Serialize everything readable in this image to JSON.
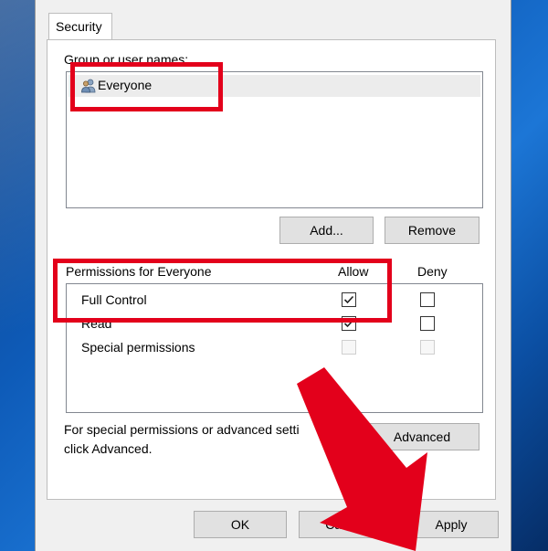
{
  "dialog": {
    "tab_label": "Security",
    "group_label": "Group or user names:",
    "users": [
      {
        "name": "Everyone",
        "icon": "users-group-icon",
        "selected": true
      }
    ],
    "add_button": "Add...",
    "remove_button": "Remove",
    "permissions_label": "Permissions for Everyone",
    "allow_header": "Allow",
    "deny_header": "Deny",
    "permissions": [
      {
        "name": "Full Control",
        "allow": true,
        "deny": false,
        "enabled": true
      },
      {
        "name": "Read",
        "allow": true,
        "deny": false,
        "enabled": true
      },
      {
        "name": "Special permissions",
        "allow": false,
        "deny": false,
        "enabled": false
      }
    ],
    "advanced_hint_line1": "For special permissions or advanced setti",
    "advanced_hint_line2": "click Advanced.",
    "advanced_button": "Advanced",
    "ok_button": "OK",
    "cancel_button": "Cancel",
    "apply_button": "Apply"
  },
  "colors": {
    "highlight": "#e3001b",
    "arrow": "#e3001b",
    "desktop": "#0e5bb8"
  }
}
